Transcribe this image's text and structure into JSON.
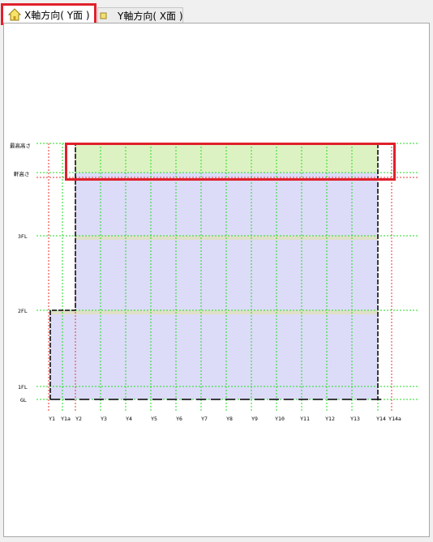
{
  "tabs": [
    {
      "label": "X軸方向( Y面 )",
      "icon": "home-icon",
      "active": true
    },
    {
      "label": "Y軸方向( X面 )",
      "icon": "square-icon",
      "active": false
    }
  ],
  "levels": [
    "最高高さ",
    "軒高さ",
    "3FL",
    "2FL",
    "1FL",
    "GL"
  ],
  "grid_labels": [
    "Y1",
    "Y1a",
    "Y2",
    "Y3",
    "Y4",
    "Y5",
    "Y6",
    "Y7",
    "Y8",
    "Y9",
    "Y10",
    "Y11",
    "Y12",
    "Y13",
    "Y14",
    "Y14a"
  ],
  "colors": {
    "highlight": "#e0202a",
    "grid_green": "#22dd22",
    "grid_red": "#ee3333",
    "wall_fill": "#dcdcf8",
    "roof_fill": "#ddf2c2",
    "floor_band": "#e0e0c8"
  }
}
